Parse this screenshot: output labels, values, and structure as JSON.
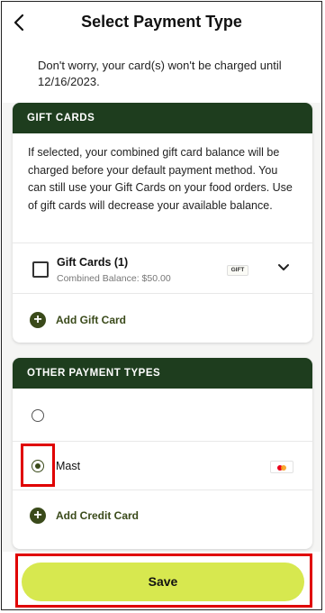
{
  "header": {
    "title": "Select Payment Type",
    "back_icon": "chevron-left-icon"
  },
  "notice": {
    "text": "Don't worry, your card(s) won't be charged until 12/16/2023."
  },
  "gift_cards": {
    "section_title": "GIFT CARDS",
    "description": "If selected, your combined gift card balance will be charged before your default payment method. You can still use your Gift Cards on your food orders. Use of gift cards will decrease your available balance.",
    "item_label": "Gift Cards (1)",
    "item_balance": "Combined Balance: $50.00",
    "badge": "GIFT",
    "checked": false,
    "add_label": "Add Gift Card"
  },
  "other_payment": {
    "section_title": "OTHER PAYMENT TYPES",
    "options": [
      {
        "label": "",
        "selected": false
      },
      {
        "label": "Mast",
        "selected": true,
        "icon": "mastercard-icon"
      }
    ],
    "add_label": "Add Credit Card"
  },
  "save": {
    "label": "Save"
  },
  "colors": {
    "section_header": "#1e3d1e",
    "accent_green": "#3a4a1a",
    "save_button": "#d7e84f",
    "highlight": "#e00000"
  }
}
